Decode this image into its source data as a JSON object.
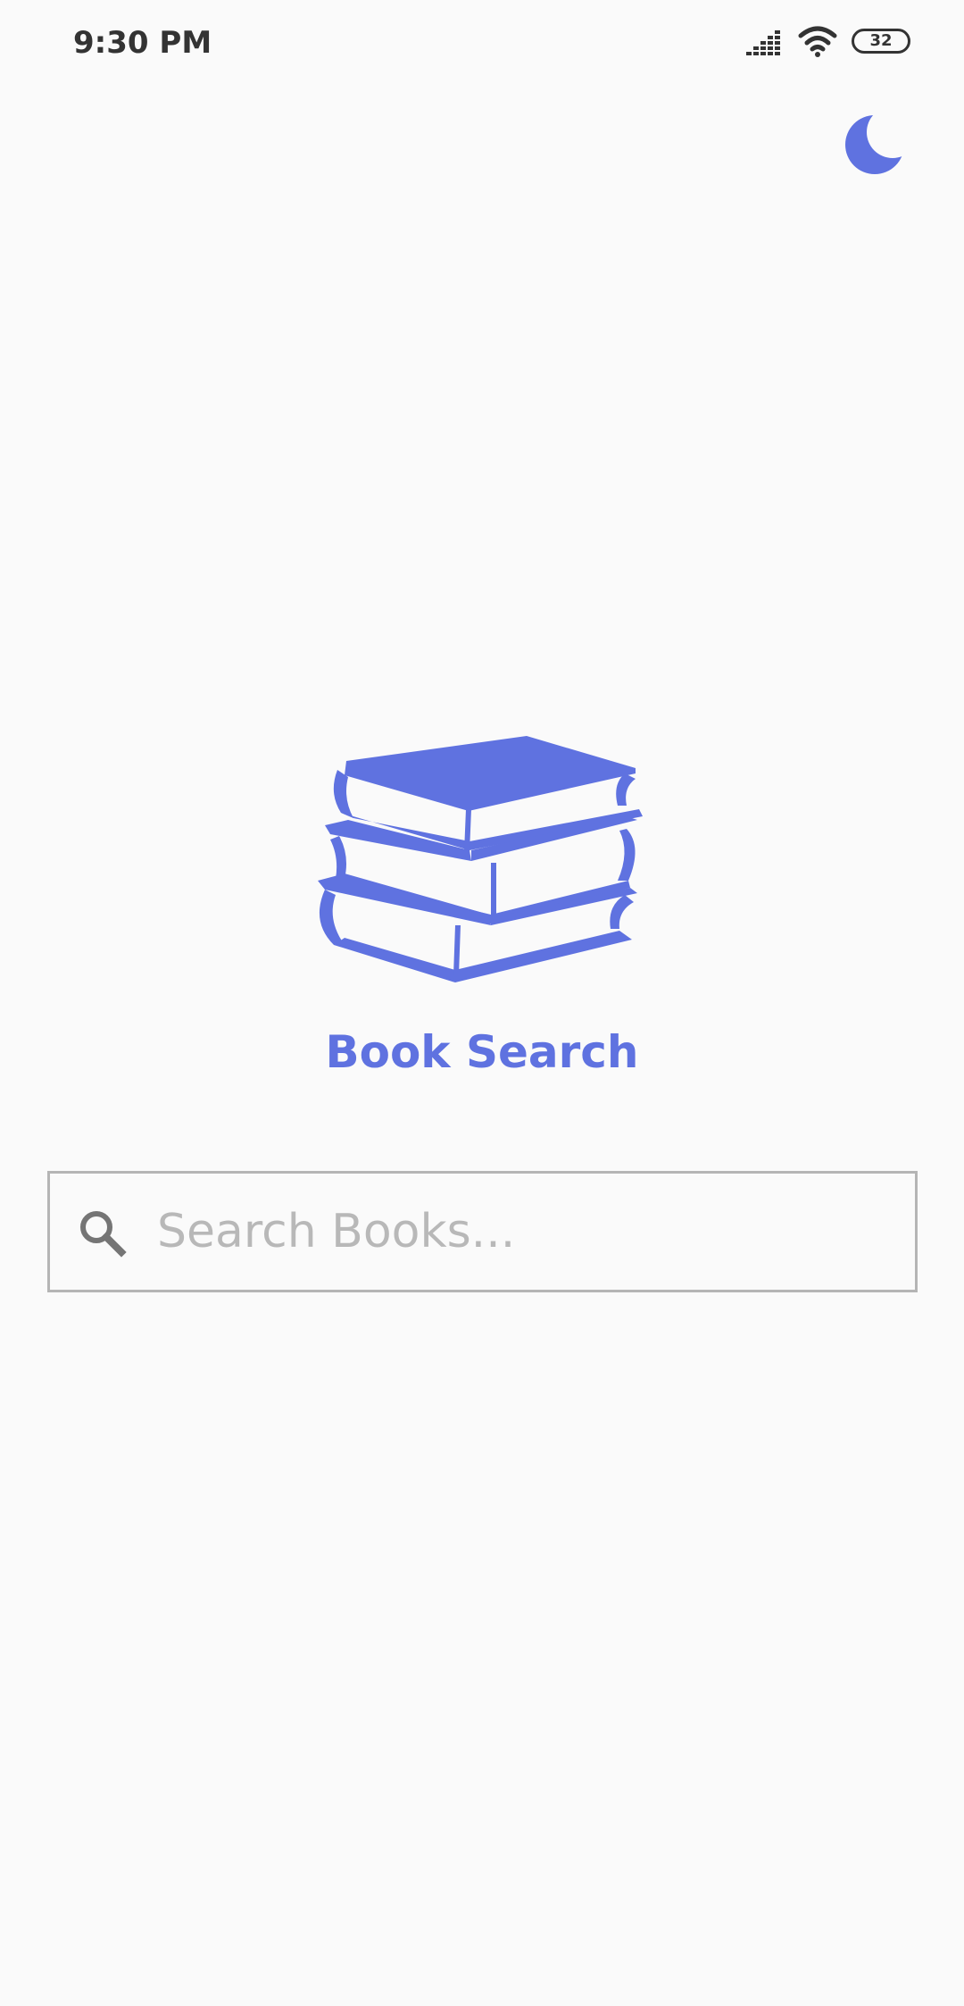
{
  "status_bar": {
    "time": "9:30 PM",
    "battery_level": "32",
    "signal_icon": "cellular-signal-icon",
    "wifi_icon": "wifi-icon",
    "battery_icon": "battery-icon"
  },
  "header": {
    "theme_toggle_icon": "moon-icon"
  },
  "hero": {
    "logo_icon": "books-stack-icon",
    "title": "Book Search"
  },
  "search": {
    "icon": "search-icon",
    "placeholder": "Search Books...",
    "value": ""
  },
  "colors": {
    "accent": "#5f72e0",
    "background": "#fafafa",
    "border": "#b5b5b5",
    "placeholder": "#b8b8b8"
  }
}
